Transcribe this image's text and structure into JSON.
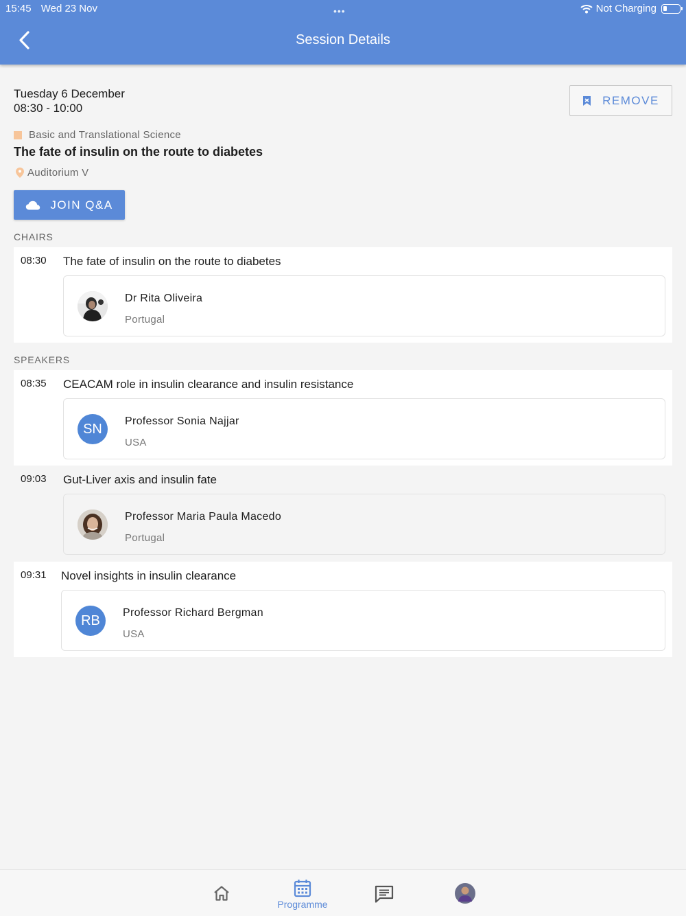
{
  "status_bar": {
    "time": "15:45",
    "date": "Wed 23 Nov",
    "charging": "Not Charging"
  },
  "header": {
    "title": "Session Details"
  },
  "session": {
    "date": "Tuesday 6 December",
    "time_range": "08:30 - 10:00",
    "remove_label": "REMOVE",
    "category": "Basic and Translational Science",
    "category_color": "#f7c59a",
    "title": "The fate of insulin on the route to diabetes",
    "location": "Auditorium V",
    "join_label": "JOIN Q&A"
  },
  "sections": {
    "chairs_label": "CHAIRS",
    "speakers_label": "SPEAKERS"
  },
  "chairs": [
    {
      "time": "08:30",
      "title": "The fate of insulin on the route to diabetes",
      "person": {
        "name": "Dr Rita Oliveira",
        "country": "Portugal",
        "avatar": "photo"
      }
    }
  ],
  "speakers": [
    {
      "time": "08:35",
      "title": "CEACAM role in insulin clearance and insulin resistance",
      "person": {
        "name": "Professor Sonia Najjar",
        "country": "USA",
        "initials": "SN"
      }
    },
    {
      "time": "09:03",
      "title": "Gut-Liver axis and insulin fate",
      "person": {
        "name": "Professor Maria Paula Macedo",
        "country": "Portugal",
        "avatar": "photo"
      }
    },
    {
      "time": "09:31",
      "title": "Novel insights in insulin clearance",
      "person": {
        "name": "Professor Richard Bergman",
        "country": "USA",
        "initials": "RB"
      }
    }
  ],
  "tabbar": {
    "programme_label": "Programme"
  },
  "colors": {
    "accent": "#5b8ad8",
    "avatar_blue": "#4f86d6",
    "background": "#f4f4f4"
  }
}
